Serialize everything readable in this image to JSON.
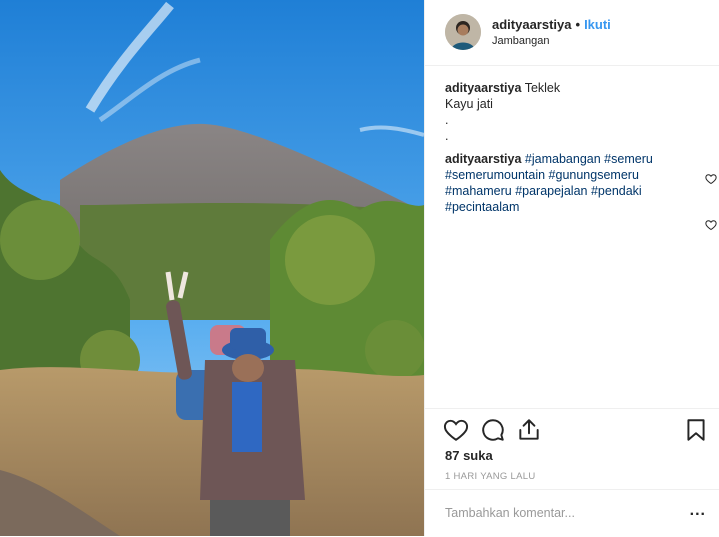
{
  "post": {
    "username": "adityaarstiya",
    "follow_label": "Ikuti",
    "separator": "•",
    "location": "Jambangan",
    "avatar_icon": "user-avatar-photo"
  },
  "caption": {
    "username": "adityaarstiya",
    "line1": "Teklek",
    "line2": "Kayu jati",
    "line3": ".",
    "line4": "."
  },
  "comment": {
    "username": "adityaarstiya",
    "hashtags": [
      "#jamabangan",
      "#semeru",
      "#semerumountain",
      "#gunungsemeru",
      "#mahameru",
      "#parapejalan",
      "#pendaki",
      "#pecintaalam"
    ]
  },
  "actions": {
    "like_icon": "heart-icon",
    "comment_icon": "comment-icon",
    "share_icon": "share-icon",
    "save_icon": "bookmark-icon"
  },
  "likes_text": "87 suka",
  "time_ago": "1 HARI YANG LALU",
  "comment_placeholder": "Tambahkan komentar...",
  "more_label": "...",
  "colors": {
    "link": "#3897f0",
    "hashtag": "#003569",
    "text": "#262626",
    "muted": "#999999",
    "border": "#efefef"
  }
}
